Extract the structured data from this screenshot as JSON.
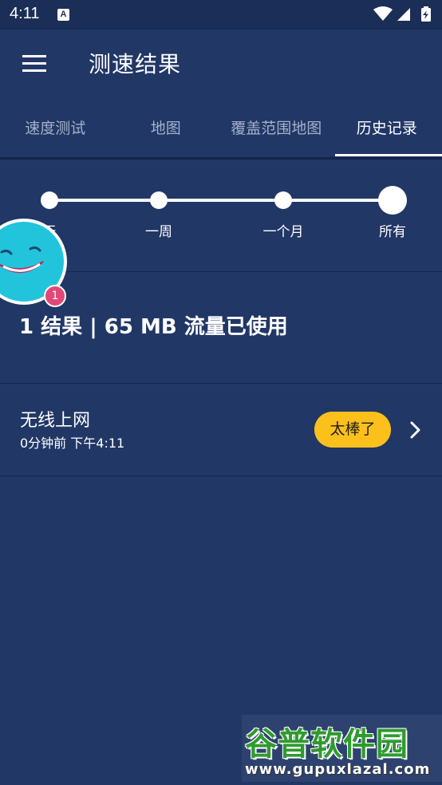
{
  "status_bar": {
    "time": "4:11",
    "notification_letter": "A"
  },
  "app_bar": {
    "title": "测速结果",
    "menu_icon": "hamburger-menu-icon"
  },
  "tabs": [
    {
      "label": "速度测试",
      "active": false
    },
    {
      "label": "地图",
      "active": false
    },
    {
      "label": "覆盖范围地图",
      "active": false
    },
    {
      "label": "历史记录",
      "active": true
    }
  ],
  "range": {
    "options": [
      "天",
      "一周",
      "一个月",
      "所有"
    ],
    "selected": "所有"
  },
  "mascot": {
    "icon": "smiley-mascot-icon",
    "badge_count": "1"
  },
  "summary": "1 结果 | 65 MB 流量已使用",
  "results": [
    {
      "name": "无线上网",
      "time": "0分钟前 下午4:11",
      "rating": "太棒了"
    }
  ],
  "colors": {
    "background": "#213766",
    "status_bar": "#1b2e57",
    "badge_yellow": "#fcc01c",
    "mascot_cyan": "#22c4dc",
    "notification_pink": "#e24778"
  },
  "watermark": {
    "title": "谷普软件园",
    "url": "www.gupuxlazal.com"
  }
}
